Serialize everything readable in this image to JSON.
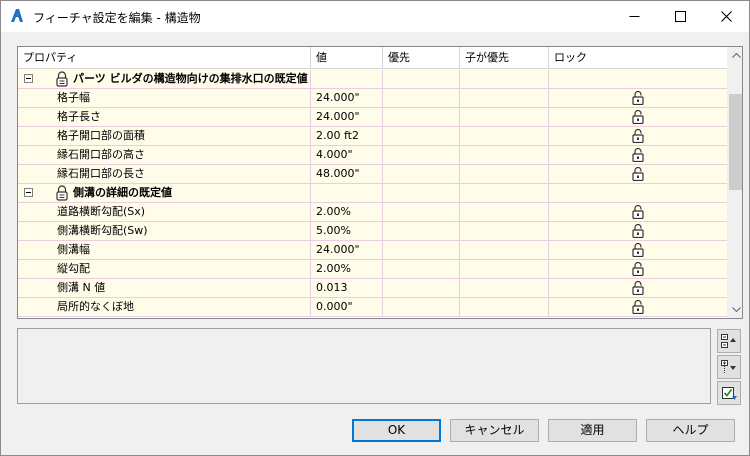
{
  "window": {
    "title": "フィーチャ設定を編集 - 構造物",
    "controls": {
      "minimize": "minimize-icon",
      "maximize": "maximize-icon",
      "close": "close-icon"
    }
  },
  "grid": {
    "columns": [
      "プロパティ",
      "値",
      "優先",
      "子が優先",
      "ロック"
    ],
    "groups": [
      {
        "label": "パーツ ビルダの構造物向けの集排水口の既定値",
        "rows": [
          {
            "name": "格子幅",
            "value": "24.000\"",
            "locked": "unlocked"
          },
          {
            "name": "格子長さ",
            "value": "24.000\"",
            "locked": "unlocked"
          },
          {
            "name": "格子開口部の面積",
            "value": "2.00 ft2",
            "locked": "unlocked"
          },
          {
            "name": "縁石開口部の高さ",
            "value": "4.000\"",
            "locked": "unlocked"
          },
          {
            "name": "縁石開口部の長さ",
            "value": "48.000\"",
            "locked": "unlocked"
          }
        ]
      },
      {
        "label": "側溝の詳細の既定値",
        "rows": [
          {
            "name": "道路横断勾配(Sx)",
            "value": "2.00%",
            "locked": "unlocked"
          },
          {
            "name": "側溝横断勾配(Sw)",
            "value": "5.00%",
            "locked": "unlocked"
          },
          {
            "name": "側溝幅",
            "value": "24.000\"",
            "locked": "unlocked"
          },
          {
            "name": "縦勾配",
            "value": "2.00%",
            "locked": "unlocked"
          },
          {
            "name": "側溝 N 値",
            "value": "0.013",
            "locked": "unlocked"
          },
          {
            "name": "局所的なくぼ地",
            "value": "0.000\"",
            "locked": "unlocked"
          }
        ]
      }
    ]
  },
  "side_buttons": [
    "expand-all-icon",
    "collapse-all-icon",
    "select-values-icon"
  ],
  "buttons": {
    "ok": "OK",
    "cancel": "キャンセル",
    "apply": "適用",
    "help": "ヘルプ"
  },
  "colors": {
    "row_background": "#fffde9",
    "grid_line": "#e7cfe0",
    "accent": "#0078d7",
    "app_icon": "#1f6fc5"
  }
}
